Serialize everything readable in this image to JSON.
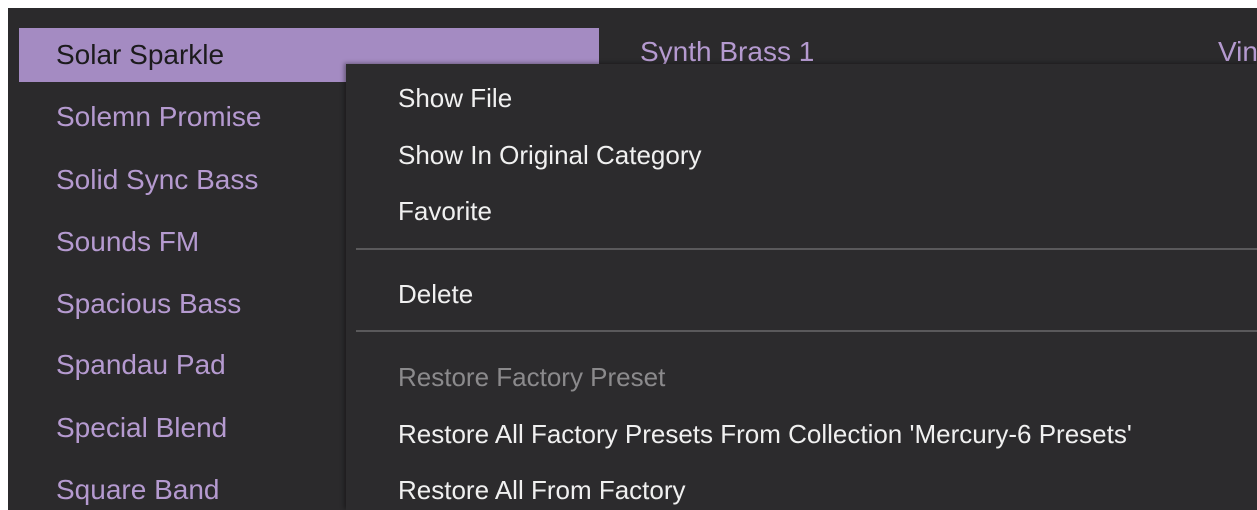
{
  "preset_list": {
    "items": [
      {
        "label": "Solar Sparkle",
        "selected": true
      },
      {
        "label": "Solemn Promise",
        "selected": false
      },
      {
        "label": "Solid Sync Bass",
        "selected": false
      },
      {
        "label": "Sounds FM",
        "selected": false
      },
      {
        "label": "Spacious Bass",
        "selected": false
      },
      {
        "label": "Spandau Pad",
        "selected": false
      },
      {
        "label": "Special Blend",
        "selected": false
      },
      {
        "label": "Square Band",
        "selected": false
      }
    ]
  },
  "second_column": {
    "first_item": "Synth Brass 1"
  },
  "third_column": {
    "first_item": "Vin"
  },
  "context_menu": {
    "show_file": "Show File",
    "show_in_original_category": "Show In Original Category",
    "favorite": "Favorite",
    "delete": "Delete",
    "restore_factory_preset": "Restore Factory Preset",
    "restore_all_from_collection": "Restore All Factory Presets From Collection 'Mercury-6 Presets'",
    "restore_all_from_factory": "Restore All From Factory"
  },
  "colors": {
    "background": "#2b2a2c",
    "preset_text": "#b59ad0",
    "selection": "#a48bc2",
    "menu_text": "#f0f0f0",
    "menu_disabled_text": "#8b8a8c"
  }
}
